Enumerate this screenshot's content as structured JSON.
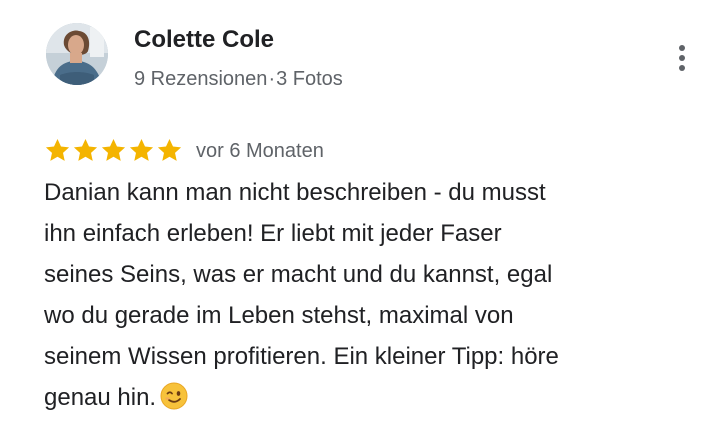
{
  "reviewer": {
    "name": "Colette Cole",
    "reviews_count": "9 Rezensionen",
    "separator": "·",
    "photos_count": "3 Fotos"
  },
  "rating": {
    "stars": 5,
    "max_stars": 5,
    "star_color": "#f4b400",
    "date": "vor 6 Monaten"
  },
  "review": {
    "lines": [
      "Danian kann man nicht beschreiben - du musst",
      "ihn einfach erleben! Er liebt mit jeder Faser",
      "seines Seins, was er macht und du kannst, egal",
      "wo du gerade im Leben stehst, maximal von",
      "seinem Wissen profitieren. Ein kleiner Tipp: höre",
      "genau hin."
    ],
    "trailing_icon": "winking-face-icon"
  },
  "menu": {
    "icon": "more-vertical-icon"
  }
}
